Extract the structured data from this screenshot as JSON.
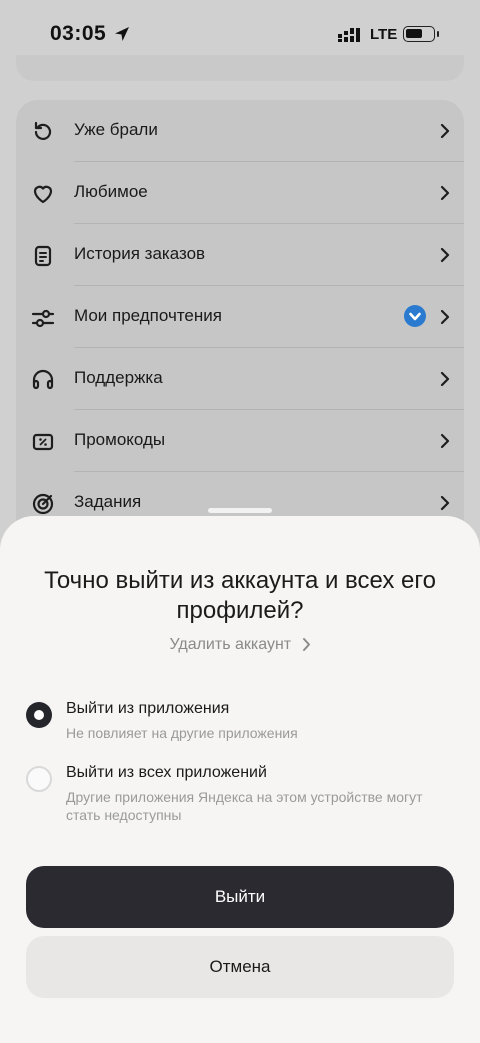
{
  "status_bar": {
    "time": "03:05",
    "network": "LTE"
  },
  "menu": {
    "items": [
      {
        "label": "Уже брали",
        "icon": "history-icon"
      },
      {
        "label": "Любимое",
        "icon": "heart-icon"
      },
      {
        "label": "История заказов",
        "icon": "receipt-icon"
      },
      {
        "label": "Мои предпочтения",
        "icon": "sliders-icon"
      },
      {
        "label": "Поддержка",
        "icon": "headset-icon"
      },
      {
        "label": "Промокоды",
        "icon": "promo-icon"
      },
      {
        "label": "Задания",
        "icon": "target-icon"
      }
    ]
  },
  "sheet": {
    "title": "Точно выйти из аккаунта и всех его профилей?",
    "delete_link": "Удалить аккаунт",
    "options": [
      {
        "title": "Выйти из приложения",
        "subtitle": "Не повлияет на другие приложения",
        "selected": true
      },
      {
        "title": "Выйти из всех приложений",
        "subtitle": "Другие приложения Яндекса на этом устройстве могут стать недоступны",
        "selected": false
      }
    ],
    "confirm_label": "Выйти",
    "cancel_label": "Отмена"
  },
  "colors": {
    "primary_button": "#2b2a31",
    "badge": "#2a7ad0",
    "sheet_bg": "#f6f5f4"
  }
}
